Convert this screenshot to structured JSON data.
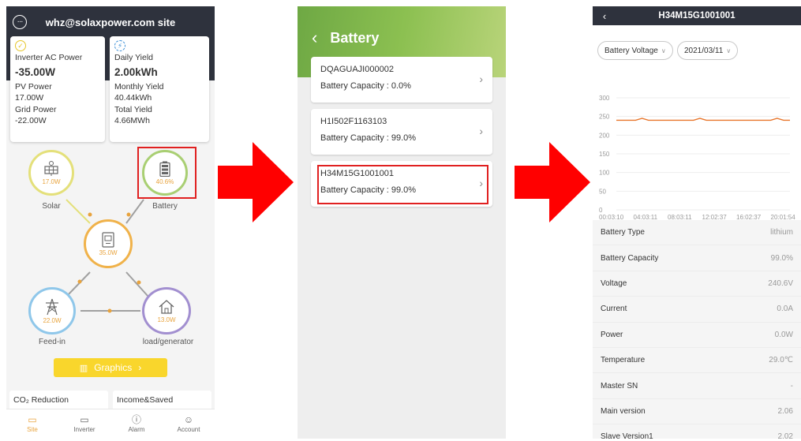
{
  "panel1": {
    "header_title": "whz@solaxpower.com site",
    "card_left": {
      "title": "Inverter AC Power",
      "value": "-35.00W",
      "sub1_label": "PV Power",
      "sub1_value": "17.00W",
      "sub2_label": "Grid Power",
      "sub2_value": "-22.00W"
    },
    "card_right": {
      "title": "Daily Yield",
      "value": "2.00kWh",
      "sub1_label": "Monthly Yield",
      "sub1_value": "40.44kWh",
      "sub2_label": "Total Yield",
      "sub2_value": "4.66MWh"
    },
    "nodes": {
      "solar": {
        "value": "17.0W",
        "label": "Solar"
      },
      "battery": {
        "value": "40.6%",
        "label": "Battery"
      },
      "inverter": {
        "value": "35.0W"
      },
      "feedin": {
        "value": "22.0W",
        "label": "Feed-in"
      },
      "load": {
        "value": "13.0W",
        "label": "load/generator"
      }
    },
    "graphics_label": "Graphics",
    "bottom_left": "CO₂ Reduction",
    "bottom_right": "Income&Saved",
    "tabs": [
      "Site",
      "Inverter",
      "Alarm",
      "Account"
    ],
    "colors": {
      "header": "#2e323d",
      "accent": "#e8a33d",
      "solar": "#e4e07a",
      "battery": "#a9cf73",
      "inverter": "#f0b24a",
      "feedin": "#8fc7ea",
      "load": "#a28fd0",
      "graphics": "#f9d62c"
    }
  },
  "panel2": {
    "title": "Battery",
    "items": [
      {
        "sn": "DQAGUAJI000002",
        "cap": "Battery Capacity : 0.0%"
      },
      {
        "sn": "H1I502F1163103",
        "cap": "Battery Capacity : 99.0%"
      },
      {
        "sn": "H34M15G1001001",
        "cap": "Battery Capacity : 99.0%"
      }
    ]
  },
  "panel3": {
    "title": "H34M15G1001001",
    "filter_type": "Battery Voltage",
    "filter_date": "2021/03/11",
    "chart_data": {
      "type": "line",
      "title": "",
      "xlabel": "",
      "ylabel": "",
      "ylim": [
        0,
        300
      ],
      "yticks": [
        "300",
        "250",
        "200",
        "150",
        "100",
        "50",
        "0"
      ],
      "xticks": [
        "00:03:10",
        "04:03:11",
        "08:03:11",
        "12:02:37",
        "16:02:37",
        "20:01:54"
      ],
      "series": [
        {
          "color": "#e8762c",
          "values": [
            240,
            240,
            240,
            240,
            245,
            240,
            240,
            240,
            240,
            240,
            240,
            240,
            240,
            245,
            240,
            240,
            240,
            240,
            240,
            240,
            240,
            240,
            240,
            240,
            240,
            245,
            240,
            240
          ]
        }
      ]
    },
    "rows": [
      {
        "k": "Battery Type",
        "v": "lithium"
      },
      {
        "k": "Battery Capacity",
        "v": "99.0%"
      },
      {
        "k": "Voltage",
        "v": "240.6V"
      },
      {
        "k": "Current",
        "v": "0.0A"
      },
      {
        "k": "Power",
        "v": "0.0W"
      },
      {
        "k": "Temperature",
        "v": "29.0℃"
      },
      {
        "k": "Master SN",
        "v": "-"
      },
      {
        "k": "Main version",
        "v": "2.06"
      },
      {
        "k": "Slave Version1",
        "v": "2.02"
      }
    ]
  }
}
